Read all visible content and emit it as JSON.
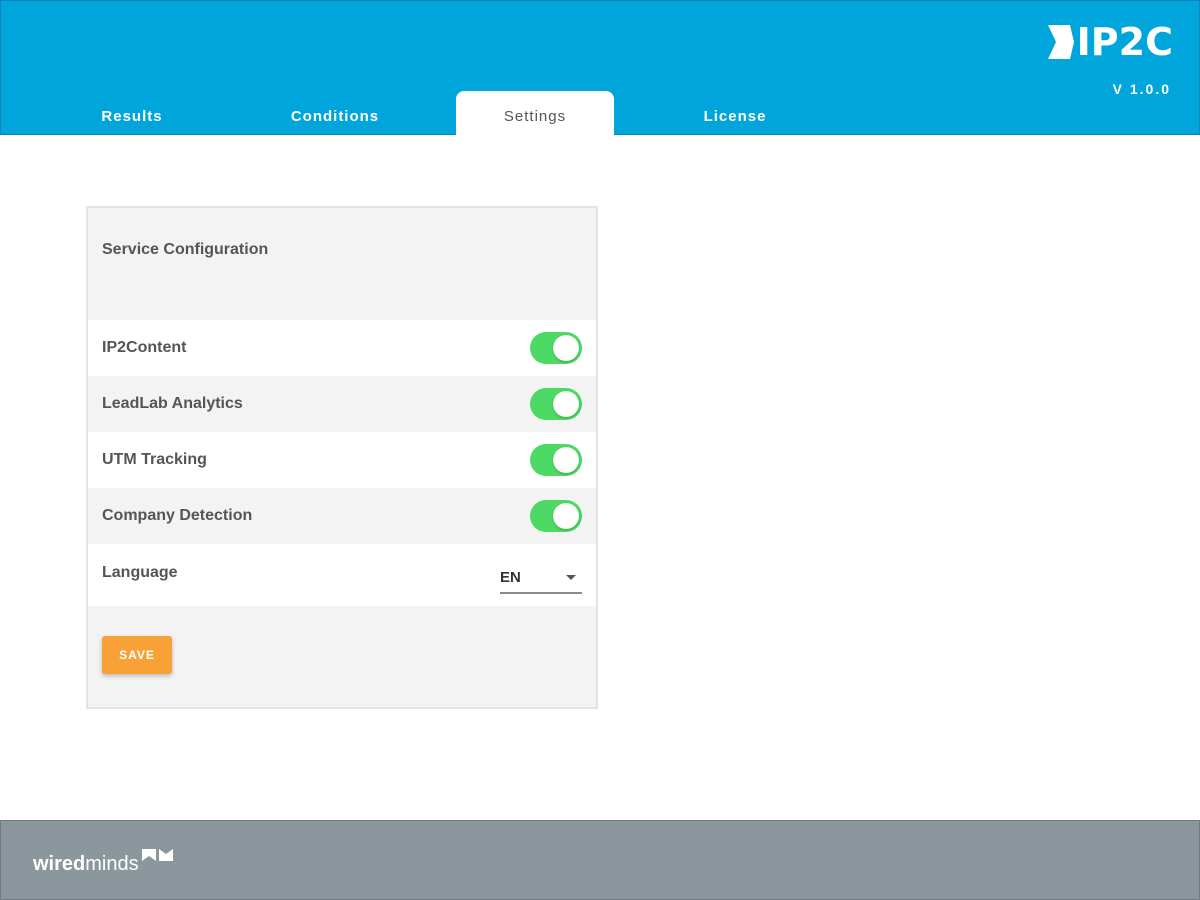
{
  "header": {
    "logo_text": "IP2C",
    "version": "V 1.0.0",
    "tabs": [
      {
        "label": "Results"
      },
      {
        "label": "Conditions"
      },
      {
        "label": "Settings"
      },
      {
        "label": "License"
      }
    ],
    "active_tab": "Settings"
  },
  "settings": {
    "title": "Service Configuration",
    "toggles": [
      {
        "label": "IP2Content",
        "on": true
      },
      {
        "label": "LeadLab Analytics",
        "on": true
      },
      {
        "label": "UTM Tracking",
        "on": true
      },
      {
        "label": "Company Detection",
        "on": true
      }
    ],
    "language": {
      "label": "Language",
      "value": "EN"
    },
    "save_label": "SAVE"
  },
  "footer": {
    "brand_bold": "wired",
    "brand_light": "minds"
  },
  "colors": {
    "header_bg": "#00a5dc",
    "toggle_on": "#4cd964",
    "save_button": "#f7a136",
    "footer_bg": "#8c979d"
  }
}
